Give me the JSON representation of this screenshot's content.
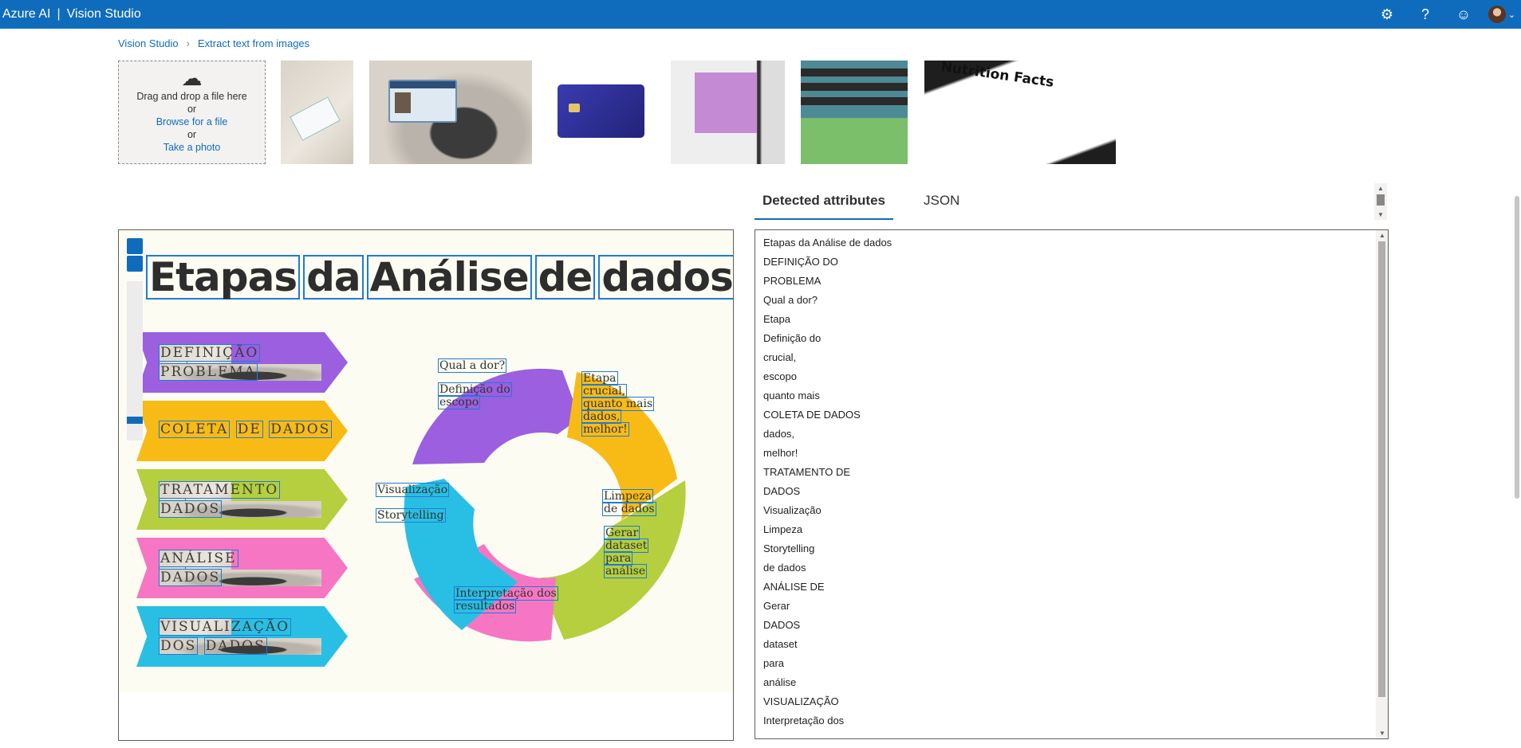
{
  "header": {
    "brand_left": "Azure AI",
    "brand_sep": "|",
    "brand_right": "Vision Studio",
    "icons": [
      "settings-icon",
      "help-icon",
      "feedback-smiley-icon",
      "user-avatar"
    ],
    "accent": "#0f6cbd"
  },
  "breadcrumb": {
    "items": [
      "Vision Studio",
      "Extract text from images"
    ]
  },
  "upload": {
    "line1": "Drag and drop a file here",
    "or1": "or",
    "browse": "Browse for a file",
    "or2": "or",
    "photo": "Take a photo"
  },
  "samples": {
    "nutrition_text": "Nutrition Facts"
  },
  "tabs": {
    "detected": "Detected attributes",
    "json": "JSON"
  },
  "infographic": {
    "title_words": [
      "Etapas",
      "da",
      "Análise",
      "de",
      "dados"
    ],
    "arrows": [
      {
        "line1": [
          "DEFINIÇÃO",
          "DO"
        ],
        "line2": [
          "PROBLEMA"
        ],
        "color": "#9b5fe0"
      },
      {
        "line1": [
          "COLETA",
          "DE",
          "DADOS"
        ],
        "line2": [],
        "color": "#f8bb16"
      },
      {
        "line1": [
          "TRATAMENTO",
          "DE"
        ],
        "line2": [
          "DADOS"
        ],
        "color": "#b5cf3f"
      },
      {
        "line1": [
          "ANÁLISE",
          "DE"
        ],
        "line2": [
          "DADOS"
        ],
        "color": "#f776c3"
      },
      {
        "line1": [
          "VISUALIZAÇÃO"
        ],
        "line2": [
          "DOS",
          "DADOS"
        ],
        "color": "#29bfe4"
      }
    ],
    "ring_labels": {
      "purple1": "Qual a dor?",
      "purple2a": "Definição do",
      "purple2b": "escopo",
      "yellow": [
        "Etapa",
        "crucial,",
        "quanto mais",
        "dados,",
        "melhor!"
      ],
      "green1": [
        "Limpeza",
        "de dados"
      ],
      "green2": [
        "Gerar",
        "dataset",
        "para",
        "análise"
      ],
      "pink": [
        "Interpretação dos",
        "resultados"
      ],
      "blue1": "Visualização",
      "blue2": "Storytelling"
    }
  },
  "results": [
    "Etapas da Análise de dados",
    "DEFINIÇÃO DO",
    "PROBLEMA",
    "Qual a dor?",
    "Etapa",
    "Definição do",
    "crucial,",
    "escopo",
    "quanto mais",
    "COLETA DE DADOS",
    "dados,",
    "melhor!",
    "TRATAMENTO DE",
    "DADOS",
    "Visualização",
    "Limpeza",
    "Storytelling",
    "de dados",
    "ANÁLISE DE",
    "Gerar",
    "DADOS",
    "dataset",
    "para",
    "análise",
    "VISUALIZAÇÃO",
    "Interpretação dos"
  ]
}
